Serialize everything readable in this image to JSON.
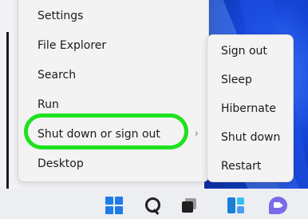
{
  "context_menu": {
    "items": [
      {
        "label": "Settings"
      },
      {
        "label": "File Explorer"
      },
      {
        "label": "Search"
      },
      {
        "label": "Run"
      },
      {
        "label": "Shut down or sign out",
        "submenu_indicator": "chevron-right-icon"
      },
      {
        "label": "Desktop"
      }
    ]
  },
  "submenu": {
    "items": [
      {
        "label": "Sign out"
      },
      {
        "label": "Sleep"
      },
      {
        "label": "Hibernate"
      },
      {
        "label": "Shut down"
      },
      {
        "label": "Restart"
      }
    ]
  },
  "taskbar": {
    "icons": [
      "start-icon",
      "search-icon",
      "task-view-icon",
      "widgets-icon",
      "chat-icon"
    ]
  },
  "colors": {
    "highlight": "#1ee21e",
    "accent": "#1f7be8",
    "wallpaper_blue": "#1546d8"
  }
}
